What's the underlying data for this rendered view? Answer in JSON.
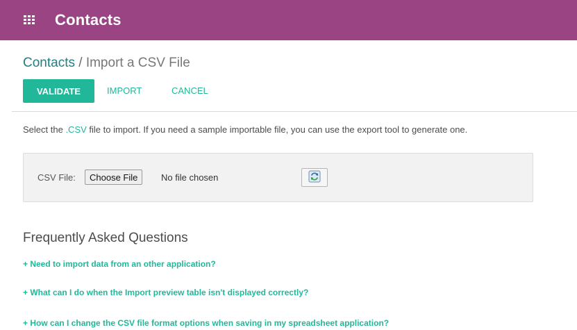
{
  "topbar": {
    "app_title": "Contacts",
    "color": "#9b4484"
  },
  "breadcrumb": {
    "parent": "Contacts",
    "separator": "/",
    "current": "Import a CSV File"
  },
  "actions": {
    "validate": "VALIDATE",
    "import": "IMPORT",
    "cancel": "CANCEL",
    "accent": "#21b799"
  },
  "intro": {
    "before": "Select the ",
    "highlight": ".CSV",
    "after": " file to import. If you need a sample importable file, you can use the export tool to generate one."
  },
  "file_panel": {
    "label": "CSV File:",
    "choose_button": "Choose File",
    "status": "No file chosen",
    "reload_icon": "reload-icon"
  },
  "faq": {
    "title": "Frequently Asked Questions",
    "items": [
      "+ Need to import data from an other application?",
      "+ What can I do when the Import preview table isn't displayed correctly?",
      "+ How can I change the CSV file format options when saving in my spreadsheet application?"
    ]
  }
}
